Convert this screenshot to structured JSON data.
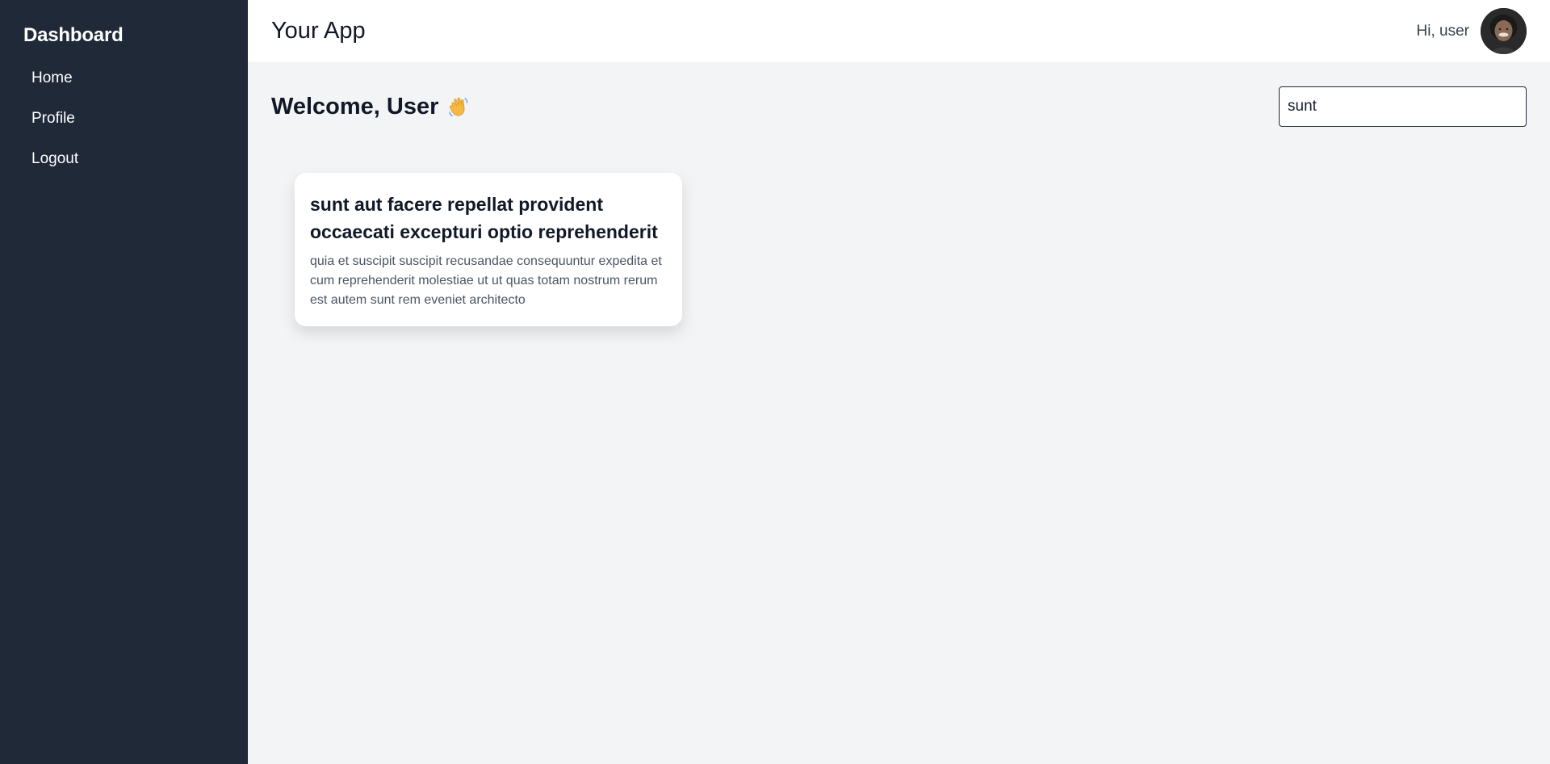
{
  "sidebar": {
    "title": "Dashboard",
    "items": [
      {
        "label": "Home"
      },
      {
        "label": "Profile"
      },
      {
        "label": "Logout"
      }
    ]
  },
  "topbar": {
    "app_title": "Your App",
    "greeting": "Hi, user"
  },
  "content": {
    "welcome": "Welcome, User",
    "search": {
      "value": "sunt"
    },
    "posts": [
      {
        "title": "sunt aut facere repellat provident occaecati excepturi optio reprehenderit",
        "body": "quia et suscipit suscipit recusandae consequuntur expedita et cum reprehenderit molestiae ut ut quas totam nostrum rerum est autem sunt rem eveniet architecto"
      }
    ]
  },
  "colors": {
    "sidebar_bg": "#1f2937",
    "page_bg": "#f3f4f6",
    "card_bg": "#ffffff"
  }
}
